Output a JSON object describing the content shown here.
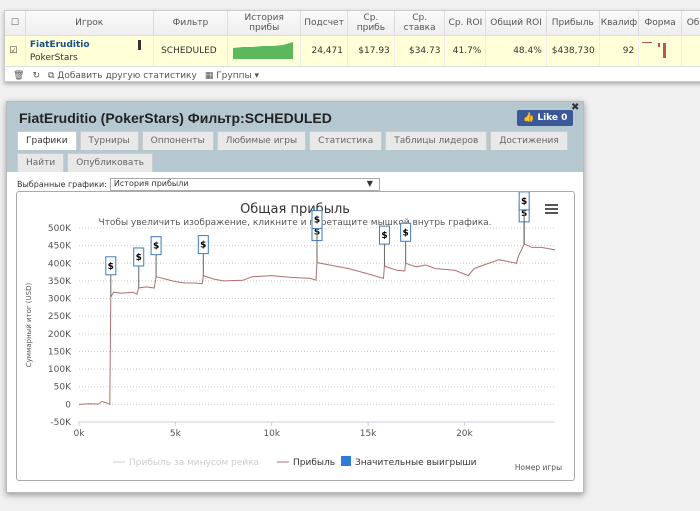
{
  "table": {
    "headers": [
      "",
      "Игрок",
      "Фильтр",
      "История прибы",
      "Подсчет",
      "Ср. прибь",
      "Ср. ставка",
      "Ср. ROI",
      "Общий ROI",
      "Прибыль",
      "Квалиф",
      "Форма",
      "Об"
    ],
    "row": {
      "player": "FiatEruditio",
      "site": "PokerStars",
      "filter": "SCHEDULED",
      "count": "24,471",
      "avg_profit": "$17.93",
      "avg_stake": "$34.73",
      "avg_roi": "41.7%",
      "total_roi": "48.4%",
      "profit": "$438,730",
      "qual": "92",
      "checked": true
    }
  },
  "toolbar": {
    "add_label": "Добавить другую статистику",
    "groups_label": "Группы"
  },
  "panel": {
    "title": "FiatEruditio (PokerStars) Фильтр:SCHEDULED",
    "like": "Like 0",
    "tabs": [
      "Графики",
      "Турниры",
      "Оппоненты",
      "Любимые игры",
      "Статистика",
      "Таблицы лидеров",
      "Достижения",
      "Найти",
      "Опубликовать"
    ],
    "selected_label": "Выбранные графики:",
    "selected_value": "История прибыли"
  },
  "chart_data": {
    "type": "line",
    "title": "Общая прибыль",
    "subtitle": "Чтобы увеличить изображение, кликните и перетащите мышкой внутрь графика.",
    "ylabel": "Суммарный итог (USD)",
    "xlabel": "Номер игры",
    "ylim": [
      -50000,
      500000
    ],
    "xlim": [
      0,
      24700
    ],
    "yticks": [
      "-50K",
      "0",
      "50K",
      "100K",
      "150K",
      "200K",
      "250K",
      "300K",
      "350K",
      "400K",
      "450K",
      "500K"
    ],
    "xticks": [
      "0k",
      "5k",
      "10k",
      "15k",
      "20k"
    ],
    "grid": true,
    "legend": [
      "Прибыль за минусом рейка",
      "Прибыль",
      "Значительные выигрыши"
    ],
    "series": [
      {
        "name": "Прибыль",
        "color": "#b07070",
        "x": [
          0,
          500,
          1000,
          1200,
          1500,
          1600,
          1650,
          1800,
          2200,
          2800,
          3000,
          3100,
          3500,
          3900,
          4000,
          4500,
          5000,
          5500,
          6000,
          6400,
          6450,
          7000,
          7500,
          8500,
          9000,
          10000,
          11000,
          12000,
          12300,
          12350,
          13000,
          14000,
          15000,
          15800,
          15850,
          16500,
          16900,
          16950,
          17500,
          18000,
          18500,
          19500,
          20200,
          20500,
          21000,
          21800,
          22700,
          22800,
          23100,
          23500,
          24000,
          24700
        ],
        "y": [
          0,
          2000,
          1000,
          8000,
          3000,
          0,
          305000,
          318000,
          315000,
          318000,
          312000,
          330000,
          333000,
          330000,
          362000,
          355000,
          348000,
          344000,
          344000,
          342000,
          365000,
          355000,
          350000,
          352000,
          362000,
          365000,
          360000,
          357000,
          352000,
          402000,
          395000,
          385000,
          370000,
          357000,
          392000,
          380000,
          378000,
          400000,
          390000,
          395000,
          385000,
          380000,
          365000,
          385000,
          395000,
          410000,
          400000,
          420000,
          455000,
          445000,
          445000,
          438000
        ]
      }
    ],
    "flags": {
      "name": "Значительные выигрыши",
      "color": "#3b7bbf",
      "x": [
        1650,
        3100,
        4000,
        6450,
        12350,
        12350,
        15850,
        16950,
        23100,
        23100
      ]
    }
  }
}
